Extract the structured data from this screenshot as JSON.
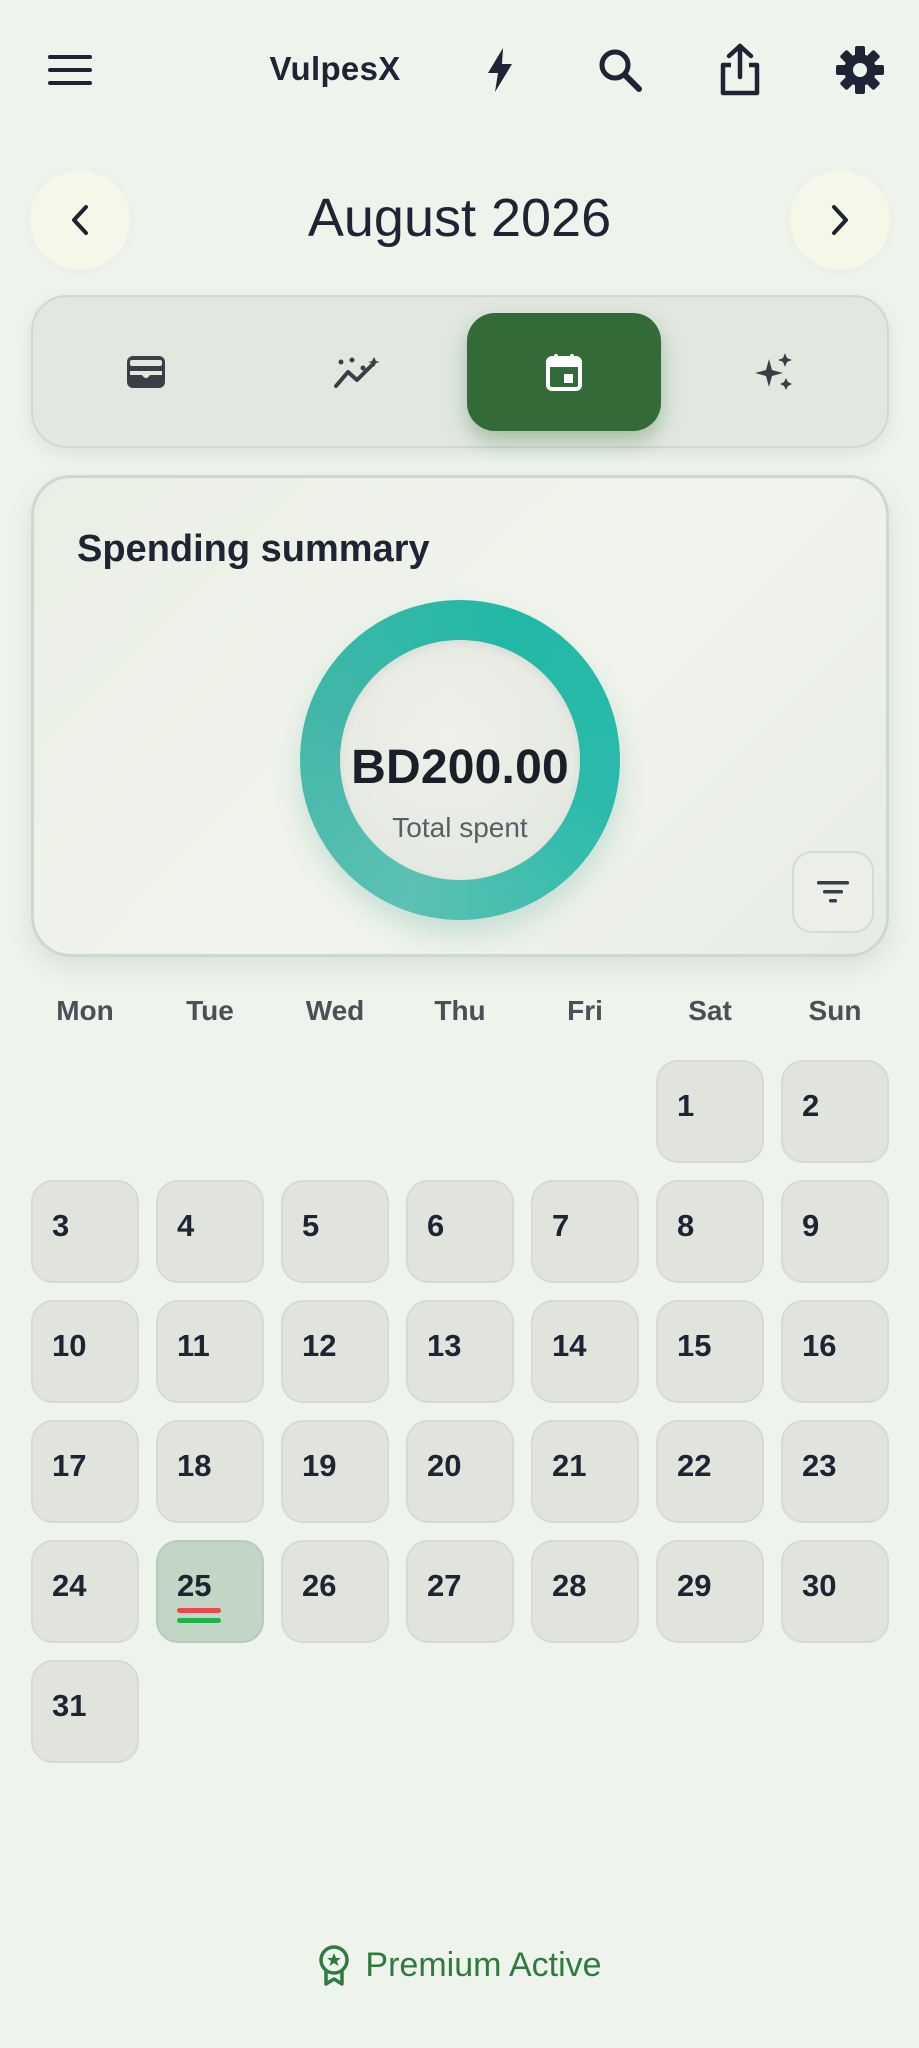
{
  "app": {
    "title": "VulpesX",
    "icons": {
      "menu": "menu-icon",
      "quick": "bolt-icon",
      "search": "search-icon",
      "share": "share-icon",
      "settings": "gear-icon"
    }
  },
  "month_nav": {
    "title": "August 2026",
    "prev_icon": "chevron-left-icon",
    "next_icon": "chevron-right-icon"
  },
  "tabs": [
    {
      "icon": "wallet-icon",
      "active": false
    },
    {
      "icon": "trend-icon",
      "active": false
    },
    {
      "icon": "calendar-icon",
      "active": true
    },
    {
      "icon": "sparkle-icon",
      "active": false
    }
  ],
  "summary": {
    "title": "Spending summary",
    "amount": "BD200.00",
    "caption": "Total spent",
    "filter_icon": "filter-icon"
  },
  "calendar": {
    "weekdays": [
      "Mon",
      "Tue",
      "Wed",
      "Thu",
      "Fri",
      "Sat",
      "Sun"
    ],
    "first_weekday_index": 5,
    "days_in_month": 31,
    "today": 25,
    "marked_day": 25,
    "marker_colors": [
      "#e8474d",
      "#1fb24a"
    ]
  },
  "footer": {
    "label": "Premium Active",
    "icon": "award-icon"
  },
  "colors": {
    "background": "#eef4ec",
    "accent": "#336b38",
    "donut": "#2cbbaa"
  }
}
